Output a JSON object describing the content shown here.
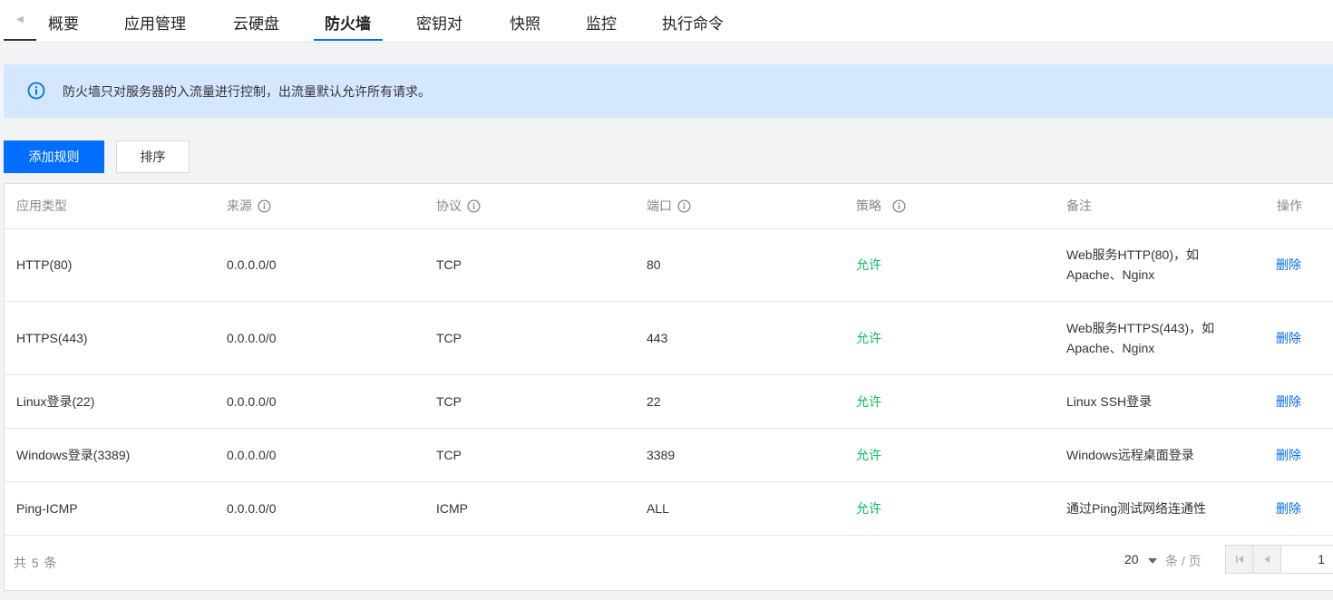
{
  "tabs": {
    "back_icon": "caret-left-icon",
    "items": [
      {
        "label": "概要"
      },
      {
        "label": "应用管理"
      },
      {
        "label": "云硬盘"
      },
      {
        "label": "防火墙"
      },
      {
        "label": "密钥对"
      },
      {
        "label": "快照"
      },
      {
        "label": "监控"
      },
      {
        "label": "执行命令"
      }
    ],
    "active": "防火墙"
  },
  "notice": {
    "icon": "info-icon",
    "text": "防火墙只对服务器的入流量进行控制，出流量默认允许所有请求。"
  },
  "toolbar": {
    "add_rule_label": "添加规则",
    "sort_label": "排序"
  },
  "table": {
    "columns": [
      "应用类型",
      "来源",
      "协议",
      "端口",
      "策略",
      "备注",
      "操作"
    ],
    "rows": [
      {
        "app": "HTTP(80)",
        "source": "0.0.0.0/0",
        "protocol": "TCP",
        "port": "80",
        "policy": "允许",
        "note1": "Web服务HTTP(80)，如",
        "note2": "Apache、Nginx",
        "action": "删除"
      },
      {
        "app": "HTTPS(443)",
        "source": "0.0.0.0/0",
        "protocol": "TCP",
        "port": "443",
        "policy": "允许",
        "note1": "Web服务HTTPS(443)，如",
        "note2": "Apache、Nginx",
        "action": "删除"
      },
      {
        "app": "Linux登录(22)",
        "source": "0.0.0.0/0",
        "protocol": "TCP",
        "port": "22",
        "policy": "允许",
        "note1": "Linux SSH登录",
        "note2": "",
        "action": "删除"
      },
      {
        "app": "Windows登录(3389)",
        "source": "0.0.0.0/0",
        "protocol": "TCP",
        "port": "3389",
        "policy": "允许",
        "note1": "Windows远程桌面登录",
        "note2": "",
        "action": "删除"
      },
      {
        "app": "Ping-ICMP",
        "source": "0.0.0.0/0",
        "protocol": "ICMP",
        "port": "ALL",
        "policy": "允许",
        "note1": "通过Ping测试网络连通性",
        "note2": "",
        "action": "删除"
      }
    ]
  },
  "footer": {
    "total_text": "共 5 条",
    "page_size": "20",
    "per_page_text": "条 / 页",
    "current_page": "1"
  },
  "colors": {
    "primary": "#006eff",
    "allow": "#0abf5b",
    "notice_bg": "#d5e7ff"
  }
}
